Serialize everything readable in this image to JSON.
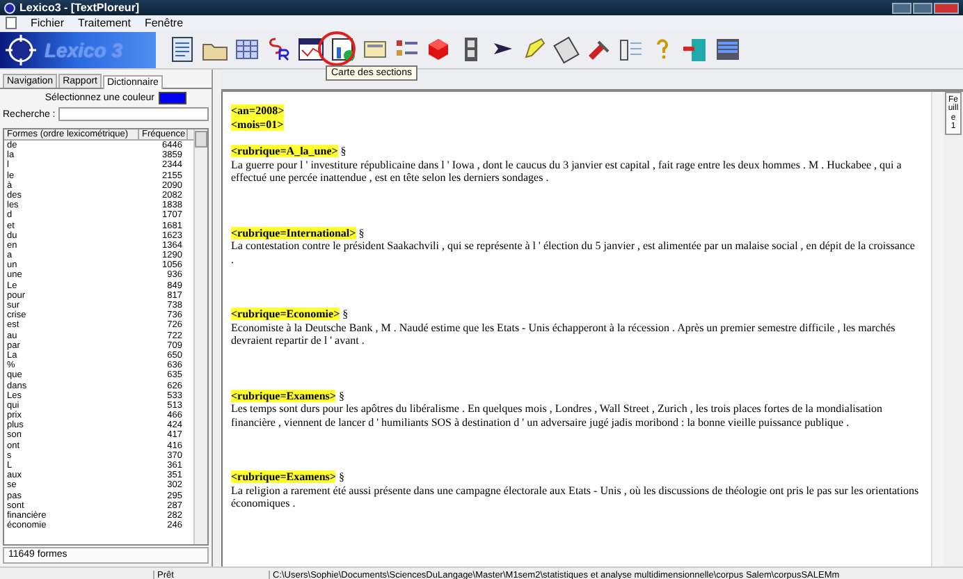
{
  "window": {
    "title": "Lexico3 - [TextPloreur]"
  },
  "menu": [
    "Fichier",
    "Traitement",
    "Fenêtre"
  ],
  "logo": {
    "text": "Lexico 3"
  },
  "toolbar": {
    "tooltip": "Carte des sections"
  },
  "sidebar": {
    "tabs": [
      {
        "label": "Navigation",
        "selected": false
      },
      {
        "label": "Rapport",
        "selected": false
      },
      {
        "label": "Dictionnaire",
        "selected": true
      }
    ],
    "color_label": "Sélectionnez une couleur",
    "color": "#0000ee",
    "search_label": "Recherche :",
    "columns": [
      "Formes (ordre lexicométrique)",
      "Fréquence"
    ],
    "rows": [
      [
        "de",
        "6446"
      ],
      [
        "la",
        "3859"
      ],
      [
        "l",
        "2344"
      ],
      [
        "le",
        "2155"
      ],
      [
        "à",
        "2090"
      ],
      [
        "des",
        "2082"
      ],
      [
        "les",
        "1838"
      ],
      [
        "d",
        "1707"
      ],
      [
        "et",
        "1681"
      ],
      [
        "du",
        "1623"
      ],
      [
        "en",
        "1364"
      ],
      [
        "a",
        "1290"
      ],
      [
        "un",
        "1056"
      ],
      [
        "une",
        "936"
      ],
      [
        "Le",
        "849"
      ],
      [
        "pour",
        "817"
      ],
      [
        "sur",
        "738"
      ],
      [
        "crise",
        "736"
      ],
      [
        "est",
        "726"
      ],
      [
        "au",
        "722"
      ],
      [
        "par",
        "709"
      ],
      [
        "La",
        "650"
      ],
      [
        "%",
        "636"
      ],
      [
        "que",
        "635"
      ],
      [
        "dans",
        "626"
      ],
      [
        "Les",
        "533"
      ],
      [
        "qui",
        "513"
      ],
      [
        "prix",
        "466"
      ],
      [
        "plus",
        "424"
      ],
      [
        "son",
        "417"
      ],
      [
        "ont",
        "416"
      ],
      [
        "s",
        "370"
      ],
      [
        "L",
        "361"
      ],
      [
        "aux",
        "351"
      ],
      [
        "se",
        "302"
      ],
      [
        "pas",
        "295"
      ],
      [
        "sont",
        "287"
      ],
      [
        "financière",
        "282"
      ],
      [
        "économie",
        "246"
      ]
    ],
    "footer": "11649 formes"
  },
  "document": {
    "header": [
      "<an=2008>",
      "<mois=01>"
    ],
    "sections": [
      {
        "tag": "<rubrique=A_la_une>",
        "mark": "§",
        "text": "La guerre pour l ' investiture républicaine dans l ' Iowa , dont le caucus du 3 janvier est capital , fait rage entre les deux hommes . M . Huckabee , qui a effectué une percée inattendue , est en tête selon les derniers sondages ."
      },
      {
        "tag": "<rubrique=International>",
        "mark": "§",
        "text": "La contestation contre le président Saakachvili , qui se représente à l ' élection du 5 janvier , est alimentée par un malaise social , en dépit de la croissance ."
      },
      {
        "tag": "<rubrique=Economie>",
        "mark": "§",
        "text": "Economiste à la Deutsche Bank , M . Naudé estime que les Etats - Unis échapperont à la récession . Après un premier semestre difficile , les marchés devraient repartir de l ' avant ."
      },
      {
        "tag": "<rubrique=Examens>",
        "mark": "§",
        "text": "Les temps sont durs pour les apôtres du libéralisme . En quelques mois , Londres , Wall Street , Zurich , les trois places fortes de la mondialisation financière , viennent de lancer d ' humiliants SOS à destination d ' un adversaire jugé jadis moribond : la bonne vieille puissance publique ."
      },
      {
        "tag": "<rubrique=Examens>",
        "mark": "§",
        "text": "La religion a rarement été aussi présente dans une campagne électorale aux Etats - Unis , où les discussions de théologie ont pris le pas sur les orientations économiques ."
      }
    ],
    "side_tab": "Feuille 1"
  },
  "status_bar": {
    "state": "Prêt",
    "path": "C:\\Users\\Sophie\\Documents\\SciencesDuLangage\\Master\\M1sem2\\statistiques et analyse multidimensionnelle\\corpus Salem\\corpusSALEMm"
  }
}
